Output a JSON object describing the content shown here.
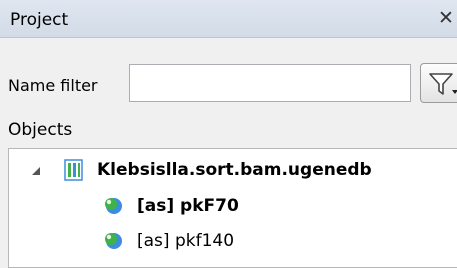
{
  "panel": {
    "title": "Project",
    "close_icon": "close-icon"
  },
  "filter": {
    "label": "Name filter",
    "value": "",
    "placeholder": "",
    "icon": "filter-icon"
  },
  "objects": {
    "label": "Objects",
    "tree": {
      "root": {
        "label": "Klebsislla.sort.bam.ugenedb",
        "expanded": true,
        "icon": "document-icon"
      },
      "children": [
        {
          "label": "[as] pkF70",
          "bold": true,
          "icon": "sequence-icon"
        },
        {
          "label": "[as] pkf140",
          "bold": false,
          "icon": "sequence-icon"
        }
      ]
    }
  },
  "colors": {
    "header_bg": "#d6dee9",
    "icon_green": "#3fb24a",
    "icon_blue": "#3c8de0"
  }
}
